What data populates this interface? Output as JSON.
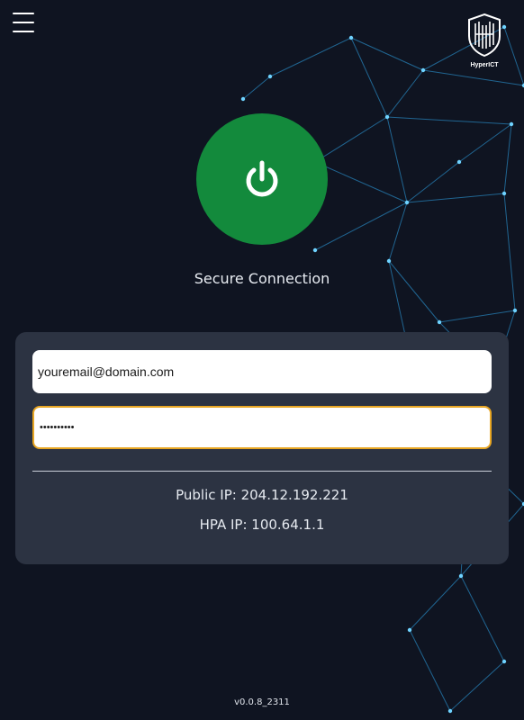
{
  "header": {
    "menu_icon": "hamburger-menu-icon",
    "logo_text": "HyperICT"
  },
  "connection": {
    "power_icon": "power-icon",
    "power_color": "#138a3c",
    "status_label": "Secure Connection"
  },
  "login": {
    "email_value": "youremail@domain.com",
    "password_value": "••••••••••",
    "password_focus_color": "#e8a623"
  },
  "info": {
    "public_ip": "Public IP: 204.12.192.221",
    "hpa_ip": "HPA IP: 100.64.1.1"
  },
  "footer": {
    "version": "v0.0.8_2311"
  },
  "theme": {
    "background": "#0f1421",
    "panel": "#2c3342",
    "network_line_color": "#2fb4ff"
  }
}
